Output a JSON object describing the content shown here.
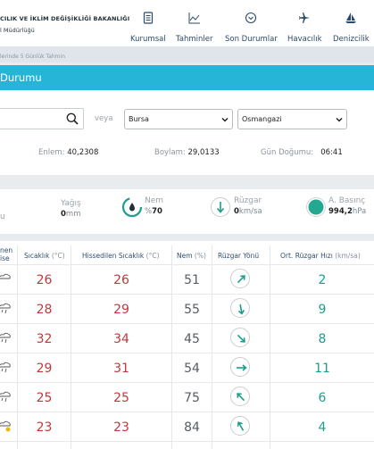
{
  "header": {
    "brand_line1": "CILIK VE İKLİM DEĞİŞİKLİĞİ BAKANLIĞI",
    "brand_line2": "l Müdürlüğü",
    "nav": [
      {
        "label": "Kurumsal",
        "icon": "document-icon"
      },
      {
        "label": "Tahminler",
        "icon": "chart-line-icon"
      },
      {
        "label": "Son Durumlar",
        "icon": "gauge-icon"
      },
      {
        "label": "Havacılık",
        "icon": "airplane-icon"
      },
      {
        "label": "Denizcilik",
        "icon": "sailboat-icon"
      }
    ]
  },
  "breadcrumb": "lerinde 5 Günlük Tahmin",
  "page_title": "Durumu",
  "search": {
    "placeholder": "",
    "or_label": "veya",
    "province": "Bursa",
    "district": "Osmangazi"
  },
  "location": {
    "lat_label": "Enlem:",
    "lat_value": "40,2308",
    "lon_label": "Boylam:",
    "lon_value": "29,0133",
    "sunrise_label": "Gün Doğumu:",
    "sunrise_value": "06:41"
  },
  "current": {
    "rain_label": "Yağış",
    "rain_value": "0",
    "rain_unit": "mm",
    "humidity_label": "Nem",
    "humidity_prefix": "%",
    "humidity_value": "70",
    "wind_label": "Rüzgar",
    "wind_value": "0",
    "wind_unit": "km/sa",
    "pressure_label": "A. Basınç",
    "pressure_value": "994,2",
    "pressure_unit": "hPa",
    "left_fragment": "u"
  },
  "table": {
    "headers": {
      "weather_line1": "nen",
      "weather_line2": "ise",
      "temp": "Sıcaklık",
      "temp_unit": "(°C)",
      "feels": "Hissedilen Sıcaklık",
      "feels_unit": "(°C)",
      "humidity": "Nem",
      "humidity_unit": "(%)",
      "wind_dir": "Rüzgar Yönü",
      "wind_speed": "Ort. Rüzgar Hızı",
      "wind_speed_unit": "(km/sa)"
    },
    "rows": [
      {
        "temp": "26",
        "feels": "26",
        "humidity": "51",
        "dir_deg": 45,
        "speed": "2",
        "icon": "cloud-icon"
      },
      {
        "temp": "28",
        "feels": "29",
        "humidity": "55",
        "dir_deg": 170,
        "speed": "9",
        "icon": "cloud-rain-icon"
      },
      {
        "temp": "32",
        "feels": "34",
        "humidity": "45",
        "dir_deg": 135,
        "speed": "8",
        "icon": "cloud-rain-icon"
      },
      {
        "temp": "29",
        "feels": "31",
        "humidity": "54",
        "dir_deg": 90,
        "speed": "11",
        "icon": "cloud-rain-icon"
      },
      {
        "temp": "25",
        "feels": "25",
        "humidity": "75",
        "dir_deg": 315,
        "speed": "6",
        "icon": "cloud-rain-icon"
      },
      {
        "temp": "23",
        "feels": "23",
        "humidity": "84",
        "dir_deg": 330,
        "speed": "4",
        "icon": "cloud-sun-icon"
      }
    ]
  },
  "colors": {
    "accent": "#26b5d7",
    "temp_red": "#c0393d",
    "wind_teal": "#1d9d8b"
  }
}
